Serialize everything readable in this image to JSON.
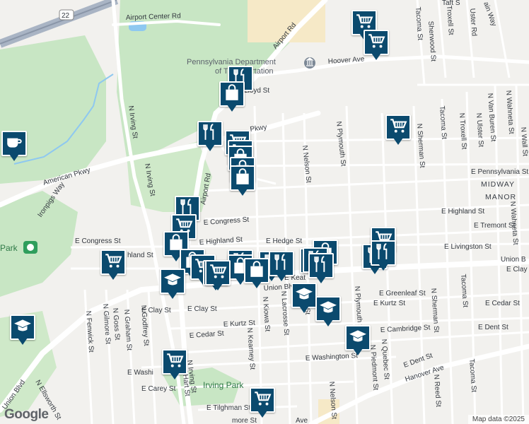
{
  "map": {
    "streets": [
      {
        "id": "airport-center-rd",
        "text": "Airport Center Rd"
      },
      {
        "id": "airport-rd",
        "text": "Airport Rd"
      },
      {
        "id": "airport-rd-2",
        "text": "Airport Rd"
      },
      {
        "id": "hoover-ave",
        "text": "Hoover Ave"
      },
      {
        "id": "lloyd-st",
        "text": "Lloyd St"
      },
      {
        "id": "pkwy",
        "text": "Pkwy"
      },
      {
        "id": "american-pkwy",
        "text": "American Pkwy"
      },
      {
        "id": "ironpigs-way",
        "text": "Ironpigs Way"
      },
      {
        "id": "n-irving-st",
        "text": "N Irving St"
      },
      {
        "id": "n-irving-st-2",
        "text": "N Irving St"
      },
      {
        "id": "n-irving-st-3",
        "text": "N Irving St"
      },
      {
        "id": "e-congress-st",
        "text": "E Congress St"
      },
      {
        "id": "e-congress-st-2",
        "text": "E Congress St"
      },
      {
        "id": "e-highland-st",
        "text": "E Highland St"
      },
      {
        "id": "e-highland-st-2",
        "text": "E Highland St"
      },
      {
        "id": "highland-st",
        "text": "hland St"
      },
      {
        "id": "e-hedge-st",
        "text": "E Hedge St"
      },
      {
        "id": "e-tremont-st",
        "text": "E Tremont St"
      },
      {
        "id": "e-livingston-st",
        "text": "E Livingston St"
      },
      {
        "id": "e-pennsylvania-st",
        "text": "E Pennsylvania St"
      },
      {
        "id": "n-nelson-st",
        "text": "N Nelson St"
      },
      {
        "id": "n-nelson-st-2",
        "text": "N Nelson St"
      },
      {
        "id": "n-plymouth-st",
        "text": "N Plymouth St"
      },
      {
        "id": "n-plymouth-st-2",
        "text": "N Plymouth St"
      },
      {
        "id": "n-sherman-st",
        "text": "N Sherman St"
      },
      {
        "id": "n-sherman-st-2",
        "text": "N Sherman St"
      },
      {
        "id": "tacoma-st",
        "text": "Tacoma St"
      },
      {
        "id": "tacoma-st-2",
        "text": "Tacoma St"
      },
      {
        "id": "tacoma-st-3",
        "text": "Tacoma St"
      },
      {
        "id": "tacoma-st-4",
        "text": "Tacoma St"
      },
      {
        "id": "n-troxell-st",
        "text": "N Troxell St"
      },
      {
        "id": "troxell-st",
        "text": "Troxell St"
      },
      {
        "id": "n-ulster-st",
        "text": "N Ulster St"
      },
      {
        "id": "uster-rd",
        "text": "Uster Rd"
      },
      {
        "id": "n-van-buren-st",
        "text": "N Van Buren St"
      },
      {
        "id": "n-wahneta-st",
        "text": "N Wahneta St"
      },
      {
        "id": "n-wahneta-st-2",
        "text": "N Wahneta St"
      },
      {
        "id": "n-wall-st",
        "text": "N Wall St"
      },
      {
        "id": "sherwood-st",
        "text": "Sherwood St"
      },
      {
        "id": "taft-st",
        "text": "Taft S"
      },
      {
        "id": "ain-way",
        "text": "ain Way"
      },
      {
        "id": "union-blvd",
        "text": "Union Blvd"
      },
      {
        "id": "union-blvd-2",
        "text": "Union Blvd"
      },
      {
        "id": "union-b",
        "text": "Union B"
      },
      {
        "id": "e-keats",
        "text": "E Keat"
      },
      {
        "id": "e-clay-st",
        "text": "E Clay St"
      },
      {
        "id": "e-clay-st-2",
        "text": "E Clay St"
      },
      {
        "id": "e-clay-st-3",
        "text": "E Clay St"
      },
      {
        "id": "e-greenleaf-st",
        "text": "E Greenleaf St"
      },
      {
        "id": "e-kurtz-st",
        "text": "E Kurtz St"
      },
      {
        "id": "e-kurtz-st-2",
        "text": "E Kurtz St"
      },
      {
        "id": "e-cedar-st",
        "text": "E Cedar St"
      },
      {
        "id": "e-cedar-st-2",
        "text": "E Cedar St"
      },
      {
        "id": "e-cambridge-st",
        "text": "E Cambridge St"
      },
      {
        "id": "e-dent-st",
        "text": "E Dent St"
      },
      {
        "id": "e-dent-st-2",
        "text": "E Dent St"
      },
      {
        "id": "e-washington-st",
        "text": "E Washington St"
      },
      {
        "id": "e-washi",
        "text": "E Washi"
      },
      {
        "id": "e-carey-st",
        "text": "E Carey St"
      },
      {
        "id": "e-tilghman-st",
        "text": "E Tilghman St"
      },
      {
        "id": "more-st",
        "text": "more St"
      },
      {
        "id": "hanover-ave",
        "text": "Hanover Ave"
      },
      {
        "id": "ave",
        "text": "Ave"
      },
      {
        "id": "n-kiowa-st",
        "text": "N Kiowa St"
      },
      {
        "id": "n-kearney-st",
        "text": "N Kearney St"
      },
      {
        "id": "n-lacrosse-st",
        "text": "N Lacrosse St"
      },
      {
        "id": "n-caldwell-st",
        "text": "well St"
      },
      {
        "id": "n-hart-st",
        "text": "N Hart St"
      },
      {
        "id": "n-fenwick-st",
        "text": "N Fenwick St"
      },
      {
        "id": "n-gilmore-st",
        "text": "N Gilmore St"
      },
      {
        "id": "n-goss-st",
        "text": "N Goss St"
      },
      {
        "id": "n-graham-st",
        "text": "N Graham St"
      },
      {
        "id": "n-godfrey-st",
        "text": "N Godfrey St"
      },
      {
        "id": "n-ellsworth-st",
        "text": "N Ellsworth St"
      },
      {
        "id": "n-quebec-st",
        "text": "N Quebec St"
      },
      {
        "id": "n-piedmont-st",
        "text": "N Piedmont St"
      },
      {
        "id": "n-reed-st",
        "text": "N Reed St"
      },
      {
        "id": "route-22",
        "text": "22"
      }
    ],
    "areas": [
      {
        "id": "midway",
        "text": "MIDWAY"
      },
      {
        "id": "manor",
        "text": "MANOR"
      }
    ],
    "pois": [
      {
        "id": "penndot-1",
        "text": "Pennsylvania Department"
      },
      {
        "id": "penndot-2",
        "text": "of Transportation"
      },
      {
        "id": "ironpigs-park",
        "text": "Park"
      },
      {
        "id": "irving-park",
        "text": "Irving Park"
      }
    ],
    "markers": [
      {
        "type": "grocery"
      },
      {
        "type": "grocery"
      },
      {
        "type": "restaurant"
      },
      {
        "type": "shopping"
      },
      {
        "type": "grocery"
      },
      {
        "type": "cafe"
      },
      {
        "type": "restaurant"
      },
      {
        "type": "grocery"
      },
      {
        "type": "grocery"
      },
      {
        "type": "shopping"
      },
      {
        "type": "shopping"
      },
      {
        "type": "shopping"
      },
      {
        "type": "restaurant"
      },
      {
        "type": "grocery"
      },
      {
        "type": "shopping"
      },
      {
        "type": "grocery"
      },
      {
        "type": "shopping"
      },
      {
        "type": "grocery"
      },
      {
        "type": "school"
      },
      {
        "type": "grocery"
      },
      {
        "type": "restaurant"
      },
      {
        "type": "shopping"
      },
      {
        "type": "restaurant"
      },
      {
        "type": "restaurant"
      },
      {
        "type": "shopping"
      },
      {
        "type": "restaurant"
      },
      {
        "type": "grocery"
      },
      {
        "type": "restaurant"
      },
      {
        "type": "shopping"
      },
      {
        "type": "school"
      },
      {
        "type": "school"
      },
      {
        "type": "school"
      },
      {
        "type": "school"
      },
      {
        "type": "grocery"
      },
      {
        "type": "grocery"
      },
      {
        "type": "grocery"
      },
      {
        "type": "restaurant"
      },
      {
        "type": "restaurant"
      },
      {
        "type": "restaurant"
      }
    ],
    "colors": {
      "marker": "#0b4a6e",
      "park": "#c8e6c4",
      "road": "#ffffff",
      "highway": "#ffe9a8",
      "land": "#f2f1ee"
    }
  },
  "logo": "Google",
  "attribution": "Map data ©2025"
}
